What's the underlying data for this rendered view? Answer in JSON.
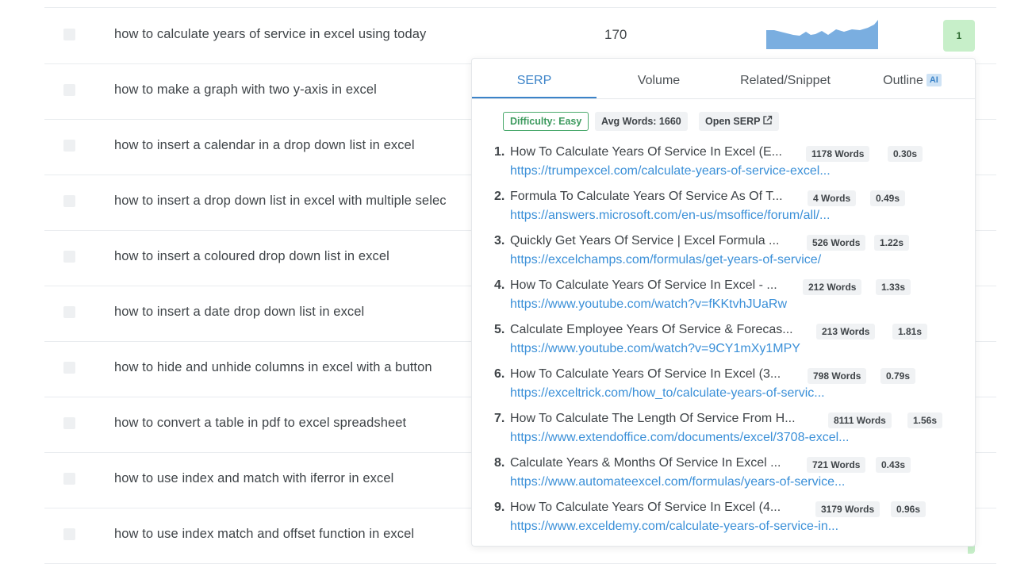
{
  "rows": [
    {
      "keyword": "how to calculate years of service in excel using today",
      "volume": "170",
      "kd": "1"
    },
    {
      "keyword": "how to make a graph with two y-axis in excel"
    },
    {
      "keyword": "how to insert a calendar in a drop down list in excel"
    },
    {
      "keyword": "how to insert a drop down list in excel with multiple selec"
    },
    {
      "keyword": "how to insert a coloured drop down list in excel"
    },
    {
      "keyword": "how to insert a date drop down list in excel"
    },
    {
      "keyword": "how to hide and unhide columns in excel with a button"
    },
    {
      "keyword": "how to convert a table in pdf to excel spreadsheet"
    },
    {
      "keyword": "how to use index and match with iferror in excel"
    },
    {
      "keyword": "how to use index match and offset function in excel"
    }
  ],
  "popup": {
    "tabs": [
      "SERP",
      "Volume",
      "Related/Snippet",
      "Outline"
    ],
    "ai_badge": "AI",
    "difficulty": "Difficulty: Easy",
    "avg_words": "Avg Words: 1660",
    "open_serp": "Open SERP",
    "results": [
      {
        "n": "1.",
        "title": "How To Calculate Years Of Service In Excel (E...",
        "words": "1178 Words",
        "time": "0.30s",
        "url": "https://trumpexcel.com/calculate-years-of-service-excel..."
      },
      {
        "n": "2.",
        "title": "Formula To Calculate Years Of Service As Of T...",
        "words": "4 Words",
        "time": "0.49s",
        "url": "https://answers.microsoft.com/en-us/msoffice/forum/all/..."
      },
      {
        "n": "3.",
        "title": "Quickly Get Years Of Service | Excel Formula ...",
        "words": "526 Words",
        "time": "1.22s",
        "url": "https://excelchamps.com/formulas/get-years-of-service/"
      },
      {
        "n": "4.",
        "title": "How To Calculate Years Of Service In Excel - ...",
        "words": "212 Words",
        "time": "1.33s",
        "url": "https://www.youtube.com/watch?v=fKKtvhJUaRw"
      },
      {
        "n": "5.",
        "title": "Calculate Employee Years Of Service & Forecas...",
        "words": "213 Words",
        "time": "1.81s",
        "url": "https://www.youtube.com/watch?v=9CY1mXy1MPY"
      },
      {
        "n": "6.",
        "title": "How To Calculate Years Of Service In Excel (3...",
        "words": "798 Words",
        "time": "0.79s",
        "url": "https://exceltrick.com/how_to/calculate-years-of-servic..."
      },
      {
        "n": "7.",
        "title": "How To Calculate The Length Of Service From H...",
        "words": "8111 Words",
        "time": "1.56s",
        "url": "https://www.extendoffice.com/documents/excel/3708-excel..."
      },
      {
        "n": "8.",
        "title": "Calculate Years & Months Of Service In Excel ...",
        "words": "721 Words",
        "time": "0.43s",
        "url": "https://www.automateexcel.com/formulas/years-of-service..."
      },
      {
        "n": "9.",
        "title": "How To Calculate Years Of Service In Excel (4...",
        "words": "3179 Words",
        "time": "0.96s",
        "url": "https://www.exceldemy.com/calculate-years-of-service-in..."
      }
    ]
  },
  "colors": {
    "accent": "#3b83c8",
    "link": "#3b90d8",
    "easy": "#4aa96c",
    "kd_bg": "#c7efc9",
    "spark": "#7aaee0"
  },
  "icons": {
    "checkbox": "checkbox-icon",
    "external": "external-link-icon"
  }
}
